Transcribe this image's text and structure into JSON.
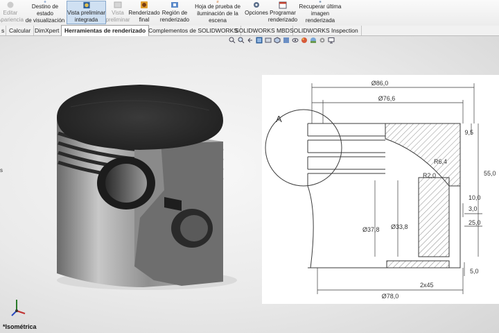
{
  "toolbar": {
    "buttons": [
      {
        "l1": "Editar",
        "l2": "Apariencia",
        "icon": "edit-appearance-icon",
        "disabled": true
      },
      {
        "l1": "Destino de estado",
        "l2": "de visualización",
        "icon": "display-state-icon",
        "disabled": false
      },
      {
        "l1": "Vista preliminar",
        "l2": "integrada",
        "icon": "integrated-preview-icon",
        "disabled": false,
        "active": true
      },
      {
        "l1": "Vista",
        "l2": "preliminar",
        "icon": "preview-window-icon",
        "disabled": true
      },
      {
        "l1": "Renderizado",
        "l2": "final",
        "icon": "final-render-icon",
        "disabled": false
      },
      {
        "l1": "Región de",
        "l2": "renderizado",
        "icon": "render-region-icon",
        "disabled": false
      },
      {
        "l1": "Hoja de prueba de",
        "l2": "iluminación de la escena",
        "icon": "scene-illumination-icon",
        "disabled": false
      },
      {
        "l1": "Opciones",
        "l2": "",
        "icon": "options-icon",
        "disabled": false
      },
      {
        "l1": "Programar",
        "l2": "renderizado",
        "icon": "schedule-render-icon",
        "disabled": false
      },
      {
        "l1": "Recuperar última",
        "l2": "imagen renderizada",
        "icon": "recall-last-render-icon",
        "disabled": false
      }
    ]
  },
  "tabs": [
    "s",
    "Calcular",
    "DimXpert",
    "Herramientas de renderizado",
    "Complementos de SOLIDWORKS",
    "SOLIDWORKS MBD",
    "SOLIDWORKS Inspection"
  ],
  "active_tab": "Herramientas de renderizado",
  "hud_icons": [
    "zoom-to-fit-icon",
    "zoom-area-icon",
    "previous-view-icon",
    "section-view-icon",
    "dynamic-annotation-icon",
    "view-orientation-icon",
    "display-style-icon",
    "hide-show-icon",
    "edit-appearance-icon",
    "apply-scene-icon",
    "view-settings-icon",
    "monitor-icon"
  ],
  "viewport": {
    "view_label": "*Isométrica",
    "left_mark": "s"
  },
  "drawing": {
    "dims": {
      "d86": "Ø86,0",
      "d76": "Ø76,6",
      "h95": "9,5",
      "h55": "55,0",
      "r64": "R6,4",
      "r2": "R2,0",
      "h10": "10,0",
      "h3": "3,0",
      "h25": "25,0",
      "d378": "Ø37,8",
      "d338": "Ø33,8",
      "h5": "5,0",
      "c2x45": "2x45",
      "d78": "Ø78,0",
      "detail": "A"
    }
  },
  "colors": {
    "toolbar_bg": "#f2f2f2",
    "active_button": "#cfe0f2",
    "drawing_line": "#3a3a3a",
    "piston_metal": "#9a9a9a",
    "piston_top": "#2c2c2c"
  }
}
